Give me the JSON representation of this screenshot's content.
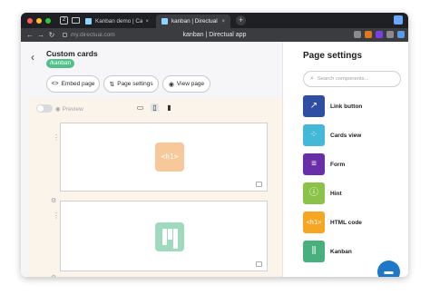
{
  "browser": {
    "tab_count": "2",
    "tabs": [
      {
        "label": "Kanban demo | Cards-in",
        "active": false
      },
      {
        "label": "kanban | Directual app",
        "active": true
      }
    ],
    "new_tab_symbol": "+",
    "close_symbol": "×",
    "url": "my.directual.com",
    "page_title": "kanban | Directual app",
    "nav": {
      "back": "←",
      "forward": "→",
      "reload": "↻"
    }
  },
  "editor": {
    "back_icon": "‹",
    "title": "Custom cards",
    "route": "/kanban",
    "actions": {
      "embed": "Embed page",
      "settings": "Page settings",
      "view": "View page"
    },
    "preview_label": "Preview",
    "placeholders": {
      "h1_label": "<h1>"
    }
  },
  "page_settings": {
    "title": "Page settings",
    "search_placeholder": "Search components...",
    "components": [
      {
        "label": "Link button",
        "icon": "arrow-icon",
        "color": "#2d4ea3"
      },
      {
        "label": "Cards view",
        "icon": "cards-icon",
        "color": "#44b8d9"
      },
      {
        "label": "Form",
        "icon": "form-icon",
        "color": "#6a2ea8"
      },
      {
        "label": "Hint",
        "icon": "info-icon",
        "color": "#8bc34a"
      },
      {
        "label": "HTML code",
        "icon": "h1-icon",
        "color": "#f5a623"
      },
      {
        "label": "Kanban",
        "icon": "kanban-icon",
        "color": "#47b07c"
      }
    ]
  },
  "colors": {
    "accent_green": "#52c08b",
    "chat_blue": "#1e78c8",
    "canvas_bg": "#fbf4ea"
  }
}
